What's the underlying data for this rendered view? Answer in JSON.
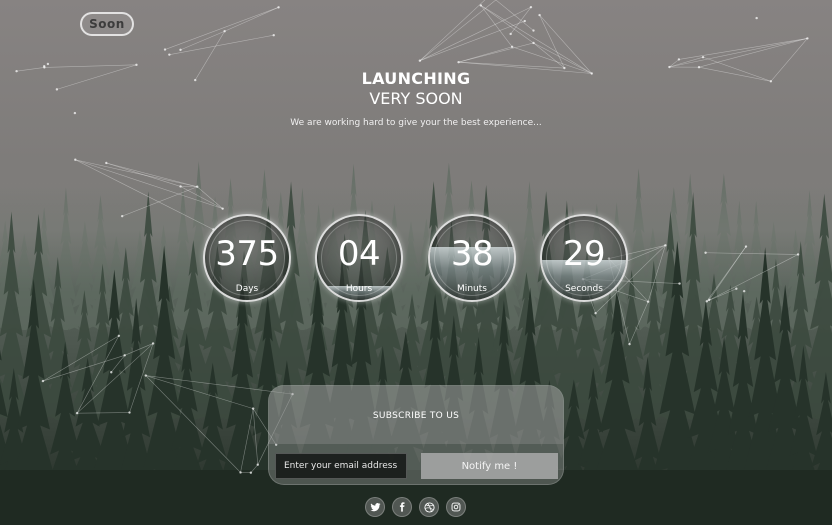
{
  "brand": {
    "logo_text": "Soon"
  },
  "hero": {
    "title": "LAUNCHING",
    "subtitle": "VERY SOON",
    "tagline": "We are working hard to give your the best experience..."
  },
  "countdown": [
    {
      "value": "375",
      "label": "Days",
      "fill": 0.0
    },
    {
      "value": "04",
      "label": "Hours",
      "fill": 0.17
    },
    {
      "value": "38",
      "label": "Minuts",
      "fill": 0.63
    },
    {
      "value": "29",
      "label": "Seconds",
      "fill": 0.48
    }
  ],
  "subscribe": {
    "title": "SUBSCRIBE TO US",
    "email_placeholder": "Enter your email address ...",
    "button_label": "Notify me !"
  },
  "social": [
    {
      "icon": "twitter-icon"
    },
    {
      "icon": "facebook-icon"
    },
    {
      "icon": "dribbble-icon"
    },
    {
      "icon": "instagram-icon"
    }
  ]
}
